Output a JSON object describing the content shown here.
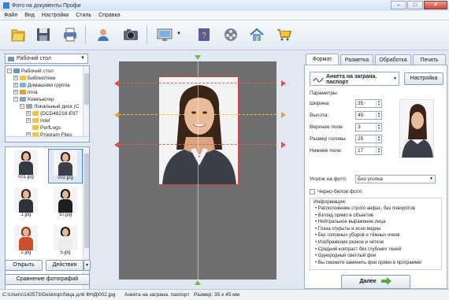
{
  "window": {
    "title": "Фото на документы Профи"
  },
  "menu": [
    "Файл",
    "Вид",
    "Настройки",
    "Стиль",
    "Справка"
  ],
  "toolbar": {
    "icons": [
      "open-folder-icon",
      "save-icon",
      "print-icon",
      "user-contact-icon",
      "camera-icon",
      "monitor-icon",
      "help-book-icon",
      "film-reel-icon",
      "home-icon",
      "cart-icon"
    ]
  },
  "left": {
    "location": "Рабочий стол",
    "tree": [
      {
        "label": "Рабочий стол",
        "level": 0,
        "exp": "−"
      },
      {
        "label": "Библиотеки",
        "level": 1,
        "exp": "+"
      },
      {
        "label": "Домашняя группа",
        "level": 1,
        "exp": "+"
      },
      {
        "label": "Irina",
        "level": 1,
        "exp": "+"
      },
      {
        "label": "Компьютер",
        "level": 1,
        "exp": "−"
      },
      {
        "label": "Локальный диск (C",
        "level": 2,
        "exp": "−"
      },
      {
        "label": "{DCD48218-E97",
        "level": 3,
        "exp": "+"
      },
      {
        "label": "Intel",
        "level": 3,
        "exp": "+"
      },
      {
        "label": "PerfLogs",
        "level": 3,
        "exp": ""
      },
      {
        "label": "Program Files",
        "level": 3,
        "exp": "+"
      }
    ],
    "thumbnails": [
      {
        "label": "001.jpg",
        "selected": false,
        "hair": "#2a1a10",
        "body": "#333a44"
      },
      {
        "label": "002.jpg",
        "selected": true,
        "hair": "#3a2418",
        "body": "#3b3f47"
      },
      {
        "label": "1.jpg",
        "selected": false,
        "hair": "#3c2415",
        "body": "#2f3138"
      },
      {
        "label": "10.jpg",
        "selected": false,
        "hair": "#1c1410",
        "body": "#1e1e22"
      },
      {
        "label": "2.jpg",
        "selected": false,
        "hair": "#8a3a1c",
        "body": "#c94f2e"
      },
      {
        "label": "5.jpg",
        "selected": false,
        "hair": "#2b1c12",
        "body": "#ececec"
      }
    ],
    "open_button": "Открыть",
    "actions_button": "Действия",
    "compare_button": "Сравнение фотографий"
  },
  "right": {
    "tabs": [
      "Формат",
      "Разметка",
      "Обработка",
      "Печать"
    ],
    "format_name": "Анкета на заграна. паспорт",
    "settings_button": "Настройка",
    "params_label": "Параметры:",
    "params": [
      {
        "label": "Ширина:",
        "value": "35"
      },
      {
        "label": "Высота:",
        "value": "45"
      },
      {
        "label": "Верхнее поле:",
        "value": "3"
      },
      {
        "label": "Размер головы:",
        "value": "25"
      },
      {
        "label": "Нижнее поле:",
        "value": "17"
      }
    ],
    "corner_label": "Уголок на фото:",
    "corner_value": "Без уголка",
    "bw_label": "Черно-белое фото",
    "info_label": "Информация:",
    "info": [
      "Расположение строго анфас, без поворотов",
      "Взгляд прямо в объектив",
      "Нейтральное выражение лица",
      "Глаза открыты и ясно видны",
      "Без головных уборов и тёмных очков",
      "Изображение резкое и чёткое",
      "Средний контраст без глубоких теней",
      "Однородный светлый фон",
      "Вы сможете заменить фон прямо в программе!"
    ],
    "next_button": "Далее"
  },
  "status": {
    "path": "C:\\Users\\142573\\Desktop\\Лица для ФНД\\002.jpg",
    "format": "Анкета на заграна. паспорт",
    "size": "Размер: 35 x 45 мм"
  }
}
